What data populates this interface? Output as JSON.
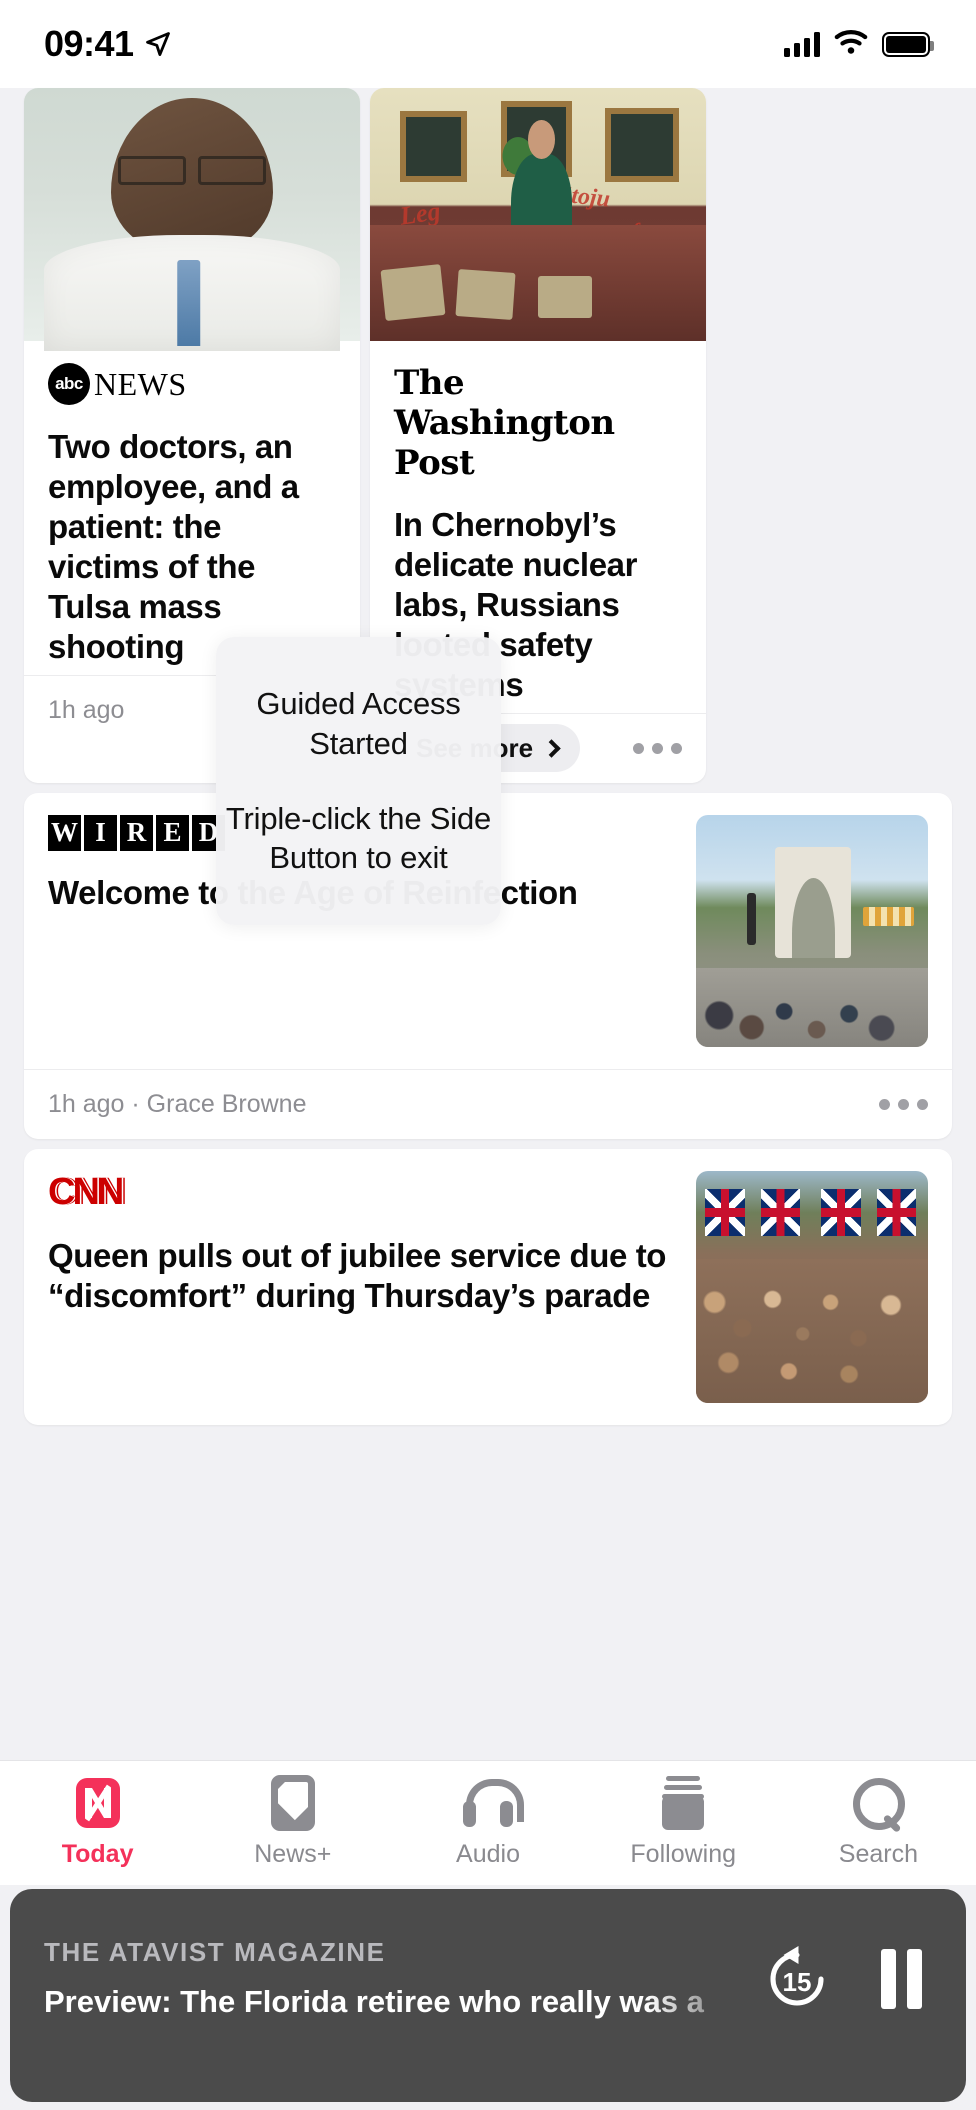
{
  "status_bar": {
    "time": "09:41",
    "location_icon": "location-arrow-icon",
    "cellular_icon": "cellular-signal-icon",
    "wifi_icon": "wifi-icon",
    "battery_icon": "battery-full-icon"
  },
  "feed": {
    "cards": [
      {
        "publisher": "ABC NEWS",
        "publisher_mark": "abc",
        "publisher_word": "NEWS",
        "headline": "Two doctors, an employee, and a patient: the victims of the Tulsa mass shooting",
        "meta": "1h ago",
        "more_menu": "more-options-icon",
        "image_alt": "doctor-portrait"
      },
      {
        "publisher": "The Washington Post",
        "headline": "In Chernobyl’s delicate nuclear labs, Russians looted safety systems",
        "see_more_label": "See more",
        "see_more_chevron": "chevron-right-icon",
        "more_menu": "more-options-icon",
        "image_alt": "looted-chernobyl-lobby"
      },
      {
        "publisher": "WIRED",
        "publisher_letters": [
          "W",
          "I",
          "R",
          "E",
          "D"
        ],
        "headline": "Welcome to the Age of Reinfection",
        "meta": "1h ago · Grace Browne",
        "more_menu": "more-options-icon",
        "image_alt": "washington-square-arch"
      },
      {
        "publisher": "CNN",
        "headline": "Queen pulls out of jubilee service due to “discomfort” during Thursday’s parade",
        "image_alt": "jubilee-crowd-the-mall"
      }
    ]
  },
  "guided_access": {
    "title": "Guided Access Started",
    "instruction": "Triple-click the Side Button to exit"
  },
  "tab_bar": {
    "active_color": "#f4315a",
    "inactive_color": "#8a8a8f",
    "tabs": [
      {
        "label": "Today",
        "icon": "apple-news-logo-icon",
        "active": true
      },
      {
        "label": "News+",
        "icon": "newspaper-icon",
        "active": false
      },
      {
        "label": "Audio",
        "icon": "headphones-icon",
        "active": false
      },
      {
        "label": "Following",
        "icon": "following-stack-icon",
        "active": false
      },
      {
        "label": "Search",
        "icon": "magnifying-glass-icon",
        "active": false
      }
    ]
  },
  "player": {
    "source": "THE ATAVIST MAGAZINE",
    "title": "Preview: The Florida retiree who really was a",
    "skip_back_label": "15",
    "skip_back_icon": "skip-back-15-icon",
    "play_pause_icon": "pause-icon",
    "background": "#4b4b4b"
  }
}
